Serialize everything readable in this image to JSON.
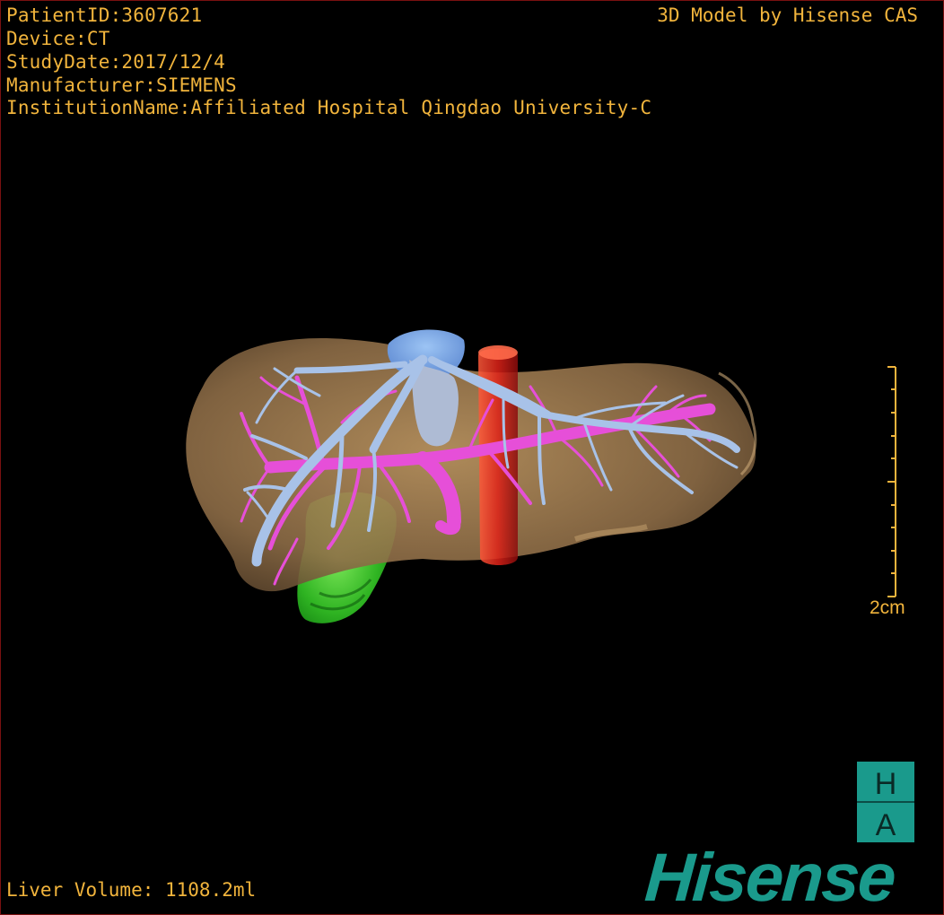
{
  "overlay": {
    "patient_id": "PatientID:3607621",
    "device": "Device:CT",
    "study_date": "StudyDate:2017/12/4",
    "manufacturer": "Manufacturer:SIEMENS",
    "institution": "InstitutionName:Affiliated Hospital Qingdao University-C",
    "credit": "3D Model by Hisense CAS",
    "liver_volume": "Liver Volume: 1108.2ml"
  },
  "scale_bar": {
    "label": "2cm"
  },
  "logo": {
    "letter_top": "H",
    "letter_bottom": "A",
    "brand": "Hisense"
  },
  "colors": {
    "text": "#f1b43c",
    "liver": "#9b7a52",
    "hepatic_vein": "#a8c2e8",
    "portal_vein": "#e64fd8",
    "aorta": "#d11a1a",
    "gallbladder": "#3fbf2f",
    "ivc": "#6f9fe6",
    "brand": "#1a9a8c"
  },
  "icons": {
    "ha_logo": "ha-logo-icon",
    "scale": "scale-bar-icon"
  }
}
